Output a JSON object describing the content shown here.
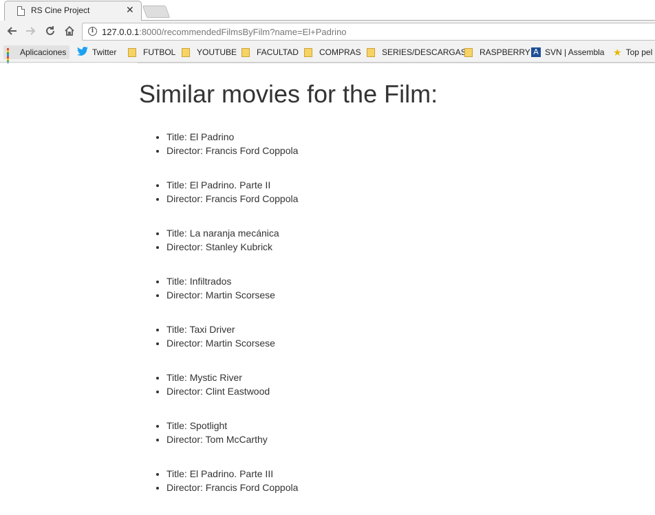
{
  "browser": {
    "tab_title": "RS Cine Project",
    "url_host": "127.0.0.1",
    "url_rest": ":8000/recommendedFilmsByFilm?name=El+Padrino",
    "bookmarks": [
      {
        "label": "Aplicaciones",
        "icon": "apps-grid-icon"
      },
      {
        "label": "Twitter",
        "icon": "twitter-icon"
      },
      {
        "label": "FUTBOL",
        "icon": "folder-icon"
      },
      {
        "label": "YOUTUBE",
        "icon": "folder-icon"
      },
      {
        "label": "FACULTAD",
        "icon": "folder-icon"
      },
      {
        "label": "COMPRAS",
        "icon": "folder-icon"
      },
      {
        "label": "SERIES/DESCARGAS",
        "icon": "folder-icon"
      },
      {
        "label": "RASPBERRY",
        "icon": "folder-icon"
      },
      {
        "label": "SVN | Assembla",
        "icon": "assembla-icon"
      },
      {
        "label": "Top pel",
        "icon": "star-icon"
      }
    ]
  },
  "page": {
    "heading": "Similar movies for the Film:",
    "films": [
      {
        "title": "Title: El Padrino",
        "director": "Director: Francis Ford Coppola"
      },
      {
        "title": "Title: El Padrino. Parte II",
        "director": "Director: Francis Ford Coppola"
      },
      {
        "title": "Title: La naranja mecánica",
        "director": "Director: Stanley Kubrick"
      },
      {
        "title": "Title: Infiltrados",
        "director": "Director: Martin Scorsese"
      },
      {
        "title": "Title: Taxi Driver",
        "director": "Director: Martin Scorsese"
      },
      {
        "title": "Title: Mystic River",
        "director": "Director: Clint Eastwood"
      },
      {
        "title": "Title: Spotlight",
        "director": "Director: Tom McCarthy"
      },
      {
        "title": "Title: El Padrino. Parte III",
        "director": "Director: Francis Ford Coppola"
      }
    ]
  }
}
